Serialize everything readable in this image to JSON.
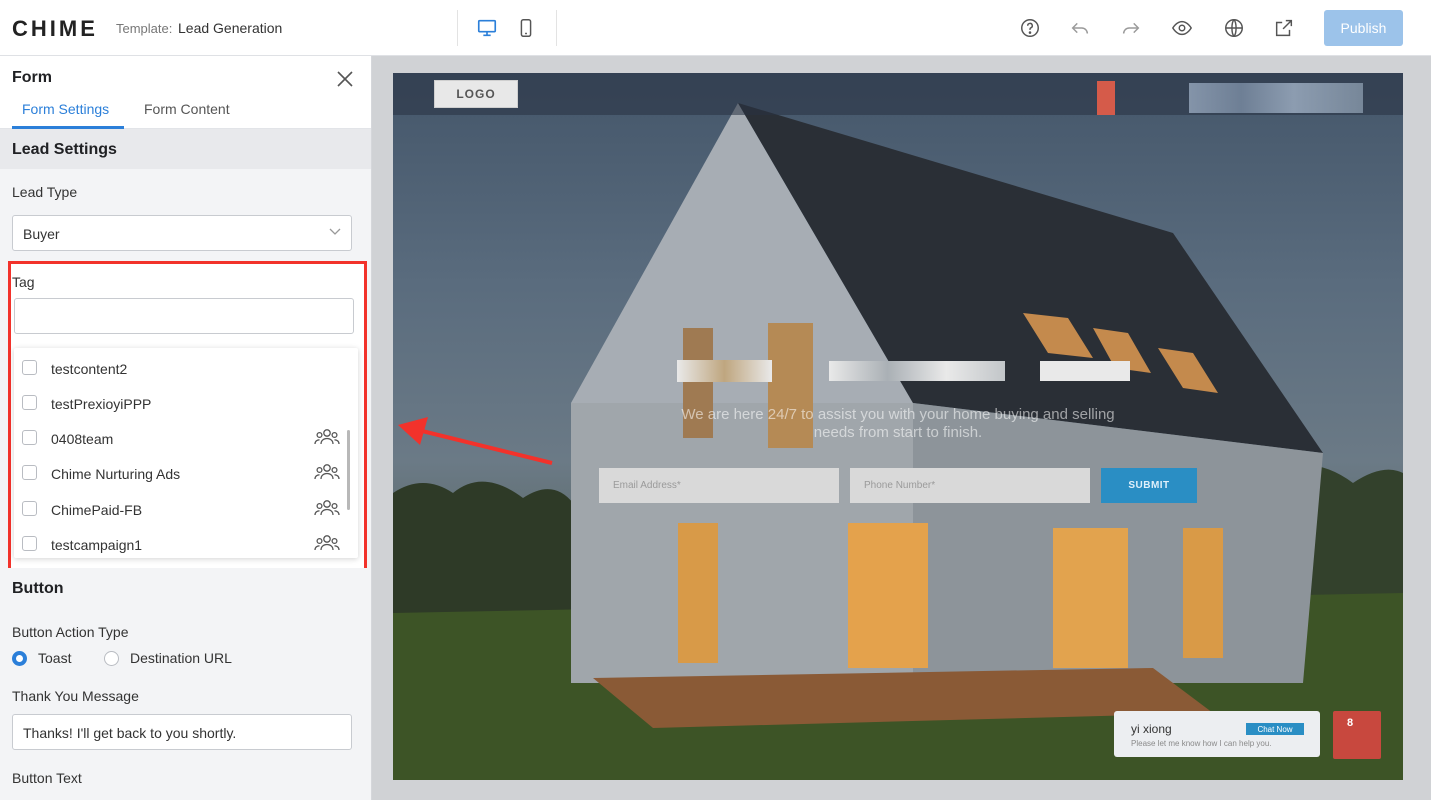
{
  "app": {
    "brand": "CHIME",
    "template_label": "Template:",
    "template_name": "Lead Generation",
    "publish_label": "Publish"
  },
  "toolbar_icons": [
    "desktop-icon",
    "mobile-icon",
    "help-icon",
    "undo-icon",
    "redo-icon",
    "preview-eye-icon",
    "globe-icon",
    "share-icon"
  ],
  "panel": {
    "title": "Form",
    "tabs": [
      {
        "label": "Form Settings",
        "active": true
      },
      {
        "label": "Form Content",
        "active": false
      }
    ],
    "lead_settings": {
      "heading": "Lead Settings",
      "lead_type_label": "Lead Type",
      "lead_type_value": "Buyer",
      "tag_label": "Tag",
      "tag_input_value": "",
      "tag_options": [
        {
          "label": "testcontent2",
          "checked": false,
          "group_icon": false
        },
        {
          "label": "testPrexioyiPPP",
          "checked": false,
          "group_icon": false
        },
        {
          "label": "0408team",
          "checked": false,
          "group_icon": true
        },
        {
          "label": "Chime Nurturing Ads",
          "checked": false,
          "group_icon": true
        },
        {
          "label": "ChimePaid-FB",
          "checked": false,
          "group_icon": true
        },
        {
          "label": "testcampaign1",
          "checked": false,
          "group_icon": true
        }
      ]
    },
    "button_section": {
      "heading": "Button",
      "action_type_label": "Button Action Type",
      "options": [
        {
          "label": "Toast",
          "selected": true
        },
        {
          "label": "Destination URL",
          "selected": false
        }
      ],
      "thank_you_label": "Thank You Message",
      "thank_you_value": "Thanks! I'll get back to you shortly.",
      "button_text_label": "Button Text"
    }
  },
  "preview": {
    "logo_label": "LOGO",
    "subtitle": "We are here 24/7 to assist you with your home buying and selling needs from start to finish.",
    "email_placeholder": "Email Address*",
    "phone_placeholder": "Phone Number*",
    "submit_label": "SUBMIT",
    "chat": {
      "name": "yi xiong",
      "button": "Chat Now",
      "message": "Please let me know how I can help you.",
      "badge": "8"
    }
  },
  "colors": {
    "accent": "#2b7fd9",
    "highlight_box": "#f2322b",
    "publish_bg": "#9cc3ea",
    "submit_bg": "#2a8ec4"
  }
}
